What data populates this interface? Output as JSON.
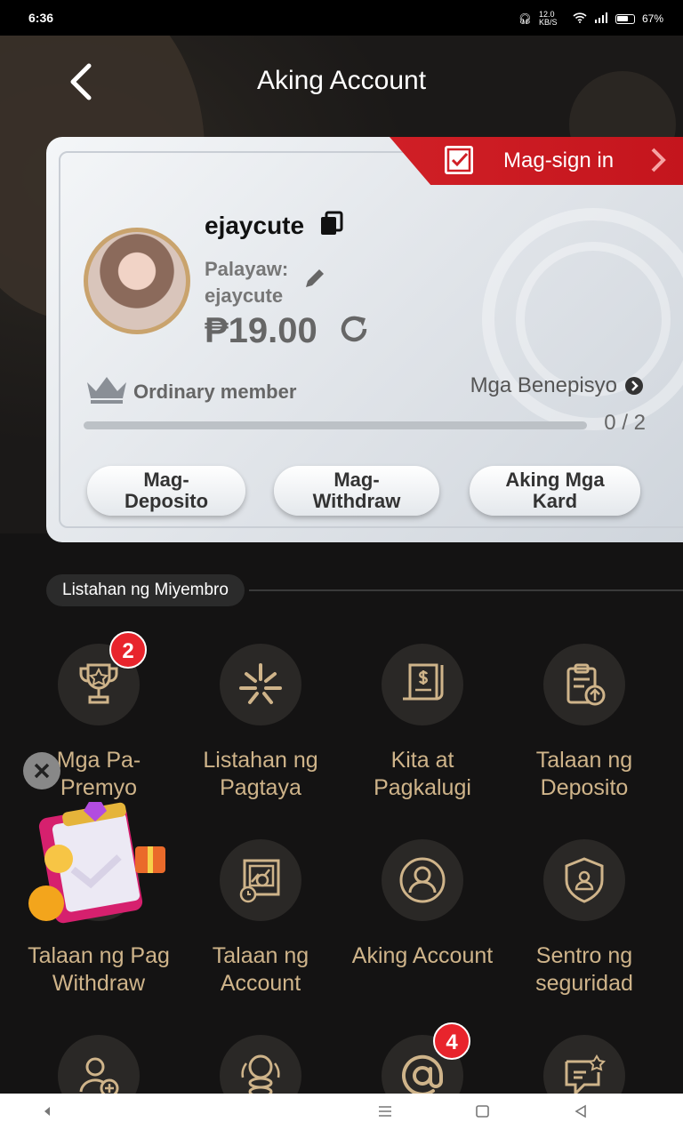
{
  "status": {
    "time": "6:36",
    "net_speed": "12.0 KB/S",
    "battery": "67%"
  },
  "header": {
    "title": "Aking Account"
  },
  "profile": {
    "signin_label": "Mag-sign in",
    "username": "ejaycute",
    "nickname_label": "Palayaw:",
    "nickname": "ejaycute",
    "balance": "₱19.00",
    "member_level": "Ordinary member",
    "benefits_label": "Mga Benepisyo",
    "progress_text": "0 / 2",
    "progress_fraction": 0
  },
  "actions": {
    "deposit": "Mag-\nDeposito",
    "withdraw": "Mag-\nWithdraw",
    "cards": "Aking Mga\nKard"
  },
  "section": {
    "title": "Listahan ng Miyembro"
  },
  "grid": [
    {
      "label": "Mga Pa-\nPremyo",
      "icon": "trophy-icon",
      "badge": "2"
    },
    {
      "label": "Listahan ng\nPagtaya",
      "icon": "sparkle-icon",
      "badge": ""
    },
    {
      "label": "Kita at\nPagkalugi",
      "icon": "receipt-dollar-icon",
      "badge": ""
    },
    {
      "label": "Talaan ng\nDeposito",
      "icon": "clipboard-upload-icon",
      "badge": ""
    },
    {
      "label": "Talaan ng Pag\nWithdraw",
      "icon": "withdraw-record-icon",
      "badge": ""
    },
    {
      "label": "Talaan ng\nAccount",
      "icon": "account-record-icon",
      "badge": ""
    },
    {
      "label": "Aking Account",
      "icon": "user-circle-icon",
      "badge": ""
    },
    {
      "label": "Sentro ng\nseguridad",
      "icon": "shield-user-icon",
      "badge": ""
    },
    {
      "label": "",
      "icon": "add-user-icon",
      "badge": ""
    },
    {
      "label": "",
      "icon": "coins-icon",
      "badge": ""
    },
    {
      "label": "",
      "icon": "at-sign-icon",
      "badge": "4"
    },
    {
      "label": "",
      "icon": "chat-star-icon",
      "badge": ""
    }
  ],
  "colors": {
    "gold": "#cfb48a",
    "signin_red": "#d01f26",
    "badge_red": "#e8242c"
  }
}
